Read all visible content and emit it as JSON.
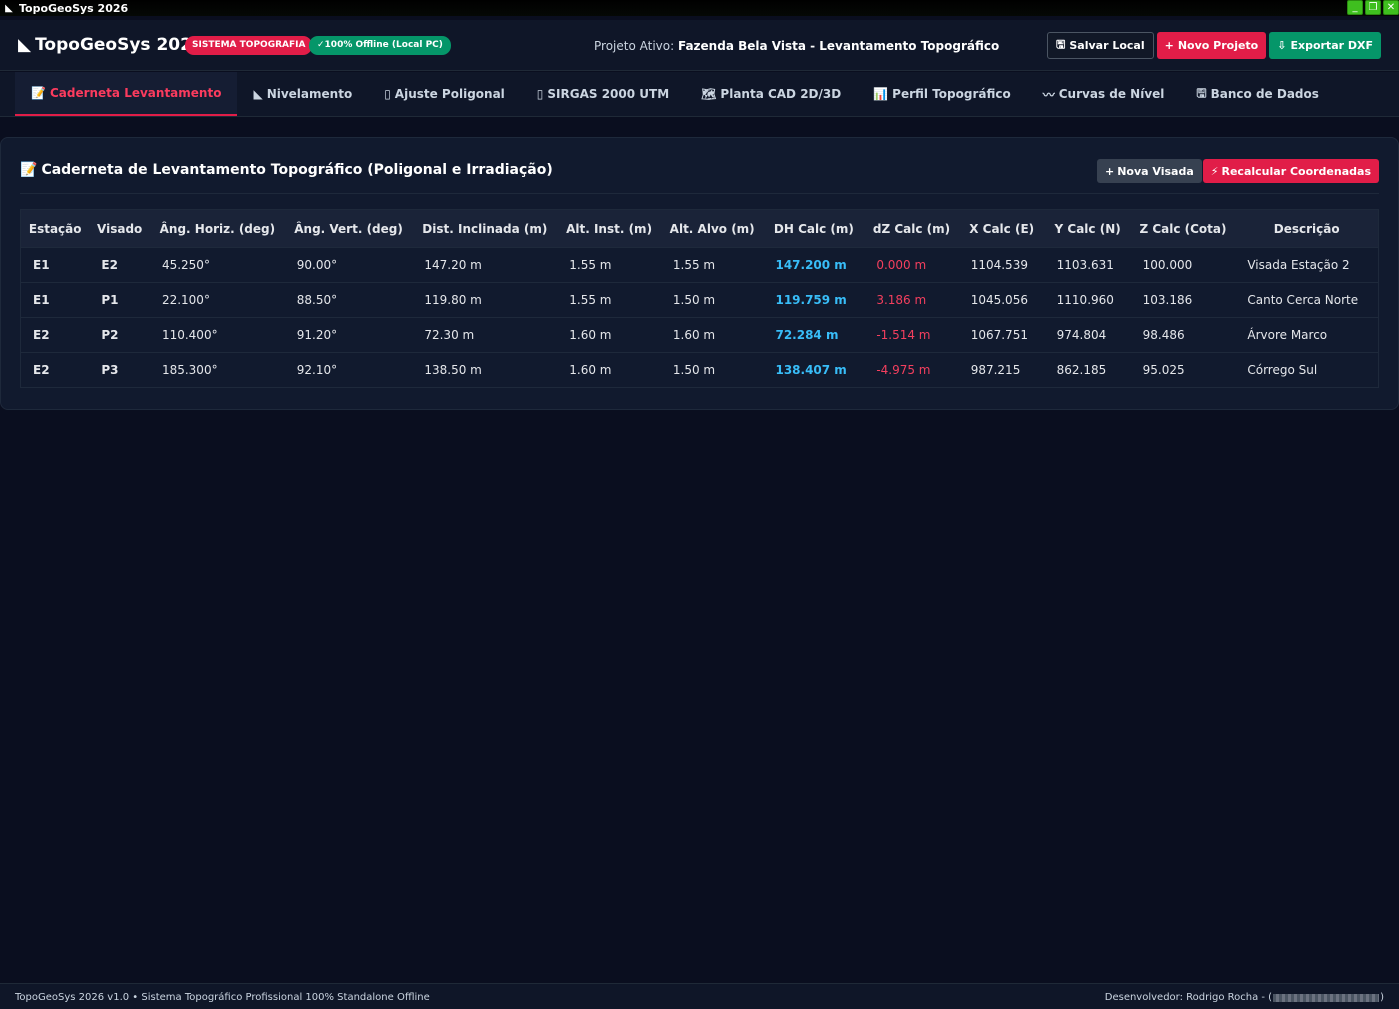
{
  "window": {
    "title": "TopoGeoSys 2026",
    "buttons": [
      "_",
      "❐",
      "✕"
    ]
  },
  "header": {
    "brand": "TopoGeoSys 2026",
    "badge_system": "SISTEMA TOPOGRAFIA",
    "badge_offline": "100% Offline (Local PC)",
    "project_label": "Projeto Ativo:",
    "project_name": "Fazenda Bela Vista - Levantamento Topográfico",
    "buttons": {
      "save": "Salvar Local",
      "new_project": "Novo Projeto",
      "export": "Exportar DXF"
    }
  },
  "tabs": [
    {
      "label": "Caderneta Levantamento",
      "icon": "📝",
      "active": true
    },
    {
      "label": "Nivelamento",
      "icon": "◣",
      "active": false
    },
    {
      "label": "Ajuste Poligonal",
      "icon": "▯",
      "active": false
    },
    {
      "label": "SIRGAS 2000 UTM",
      "icon": "▯",
      "active": false
    },
    {
      "label": "Planta CAD 2D/3D",
      "icon": "🗺",
      "active": false
    },
    {
      "label": "Perfil Topográfico",
      "icon": "📊",
      "active": false
    },
    {
      "label": "Curvas de Nível",
      "icon": "〰",
      "active": false
    },
    {
      "label": "Banco de Dados",
      "icon": "🖫",
      "active": false
    }
  ],
  "panel": {
    "title": "Caderneta de Levantamento Topográfico (Poligonal e Irradiação)",
    "buttons": {
      "new_sight": "Nova Visada",
      "recalc": "Recalcular Coordenadas"
    }
  },
  "table": {
    "headers": [
      "Estação",
      "Visado",
      "Âng. Horiz. (deg)",
      "Âng. Vert. (deg)",
      "Dist. Inclinada (m)",
      "Alt. Inst. (m)",
      "Alt. Alvo (m)",
      "DH Calc (m)",
      "dZ Calc (m)",
      "X Calc (E)",
      "Y Calc (N)",
      "Z Calc (Cota)",
      "Descrição"
    ],
    "rows": [
      [
        "E1",
        "E2",
        "45.250°",
        "90.00°",
        "147.20 m",
        "1.55 m",
        "1.55 m",
        "147.200 m",
        "0.000 m",
        "1104.539",
        "1103.631",
        "100.000",
        "Visada Estação 2"
      ],
      [
        "E1",
        "P1",
        "22.100°",
        "88.50°",
        "119.80 m",
        "1.55 m",
        "1.50 m",
        "119.759 m",
        "3.186 m",
        "1045.056",
        "1110.960",
        "103.186",
        "Canto Cerca Norte"
      ],
      [
        "E2",
        "P2",
        "110.400°",
        "91.20°",
        "72.30 m",
        "1.60 m",
        "1.60 m",
        "72.284 m",
        "-1.514 m",
        "1067.751",
        "974.804",
        "98.486",
        "Árvore Marco"
      ],
      [
        "E2",
        "P3",
        "185.300°",
        "92.10°",
        "138.50 m",
        "1.60 m",
        "1.50 m",
        "138.407 m",
        "-4.975 m",
        "987.215",
        "862.185",
        "95.025",
        "Córrego Sul"
      ]
    ]
  },
  "footer": {
    "left": "TopoGeoSys 2026 v1.0 • Sistema Topográfico Profissional 100% Standalone Offline",
    "right_prefix": "Desenvolvedor: Rodrigo Rocha - (",
    "right_suffix": ")"
  },
  "colors": {
    "accent_red": "#e11d48",
    "accent_green": "#059669",
    "dh_blue": "#38bdf8",
    "dz_red": "#f43f5e"
  }
}
